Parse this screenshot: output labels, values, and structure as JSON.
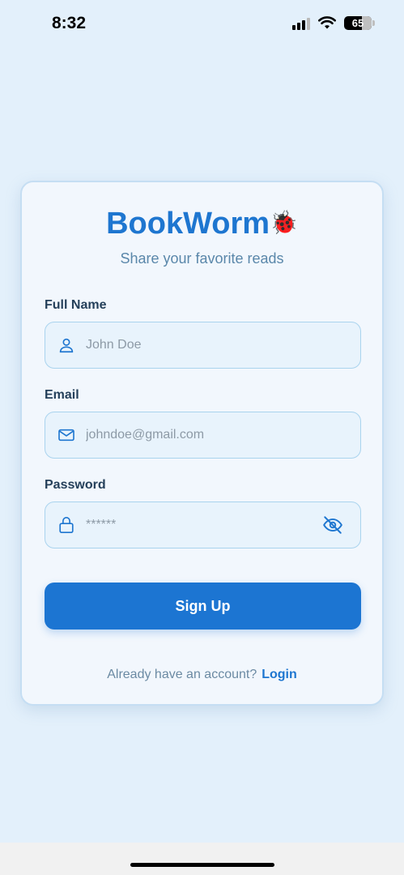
{
  "status_bar": {
    "time": "8:32",
    "battery": "65"
  },
  "app": {
    "title": "BookWorm",
    "title_emoji": "🐞",
    "tagline": "Share your favorite reads",
    "accent_color": "#1e76d0"
  },
  "form": {
    "full_name": {
      "label": "Full Name",
      "placeholder": "John Doe",
      "value": "",
      "icon": "user-icon"
    },
    "email": {
      "label": "Email",
      "placeholder": "johndoe@gmail.com",
      "value": "",
      "icon": "mail-icon"
    },
    "password": {
      "label": "Password",
      "placeholder": "******",
      "value": "",
      "icon": "lock-icon",
      "toggle_icon": "eye-off-icon"
    },
    "submit_label": "Sign Up"
  },
  "footer": {
    "question": "Already have an account?",
    "login_label": "Login"
  }
}
